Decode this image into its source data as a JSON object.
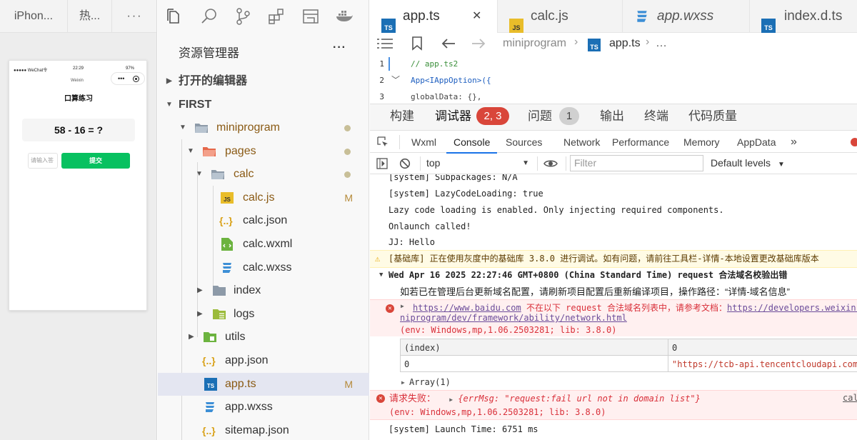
{
  "simulator": {
    "tabs": [
      "iPhon...",
      "热...",
      "···"
    ],
    "status_left": "●●●●● WeChat令",
    "status_time": "22:29",
    "status_battery": "97%",
    "nav_title": "Weixin",
    "page_title": "口算练习",
    "question": "58 - 16 = ?",
    "input_placeholder": "请输入答",
    "submit_label": "提交"
  },
  "explorer": {
    "title": "资源管理器",
    "more": "···",
    "open_editors": "打开的编辑器",
    "root": "FIRST",
    "tree": [
      {
        "label": "miniprogram",
        "status": ""
      },
      {
        "label": "pages",
        "status": ""
      },
      {
        "label": "calc",
        "status": ""
      },
      {
        "label": "calc.js",
        "status": "M"
      },
      {
        "label": "calc.json",
        "status": ""
      },
      {
        "label": "calc.wxml",
        "status": ""
      },
      {
        "label": "calc.wxss",
        "status": ""
      },
      {
        "label": "index",
        "status": ""
      },
      {
        "label": "logs",
        "status": ""
      },
      {
        "label": "utils",
        "status": ""
      },
      {
        "label": "app.json",
        "status": ""
      },
      {
        "label": "app.ts",
        "status": "M"
      },
      {
        "label": "app.wxss",
        "status": ""
      },
      {
        "label": "sitemap.json",
        "status": ""
      }
    ]
  },
  "editor": {
    "tabs": [
      {
        "label": "app.ts",
        "badge": "TS"
      },
      {
        "label": "calc.js",
        "badge": "JS"
      },
      {
        "label": "app.wxss",
        "badge": "CSS"
      },
      {
        "label": "index.d.ts",
        "badge": "TS"
      }
    ],
    "close_glyph": "✕",
    "breadcrumb": {
      "folder": "miniprogram",
      "file": "app.ts",
      "rest": "…"
    },
    "code": [
      {
        "num": "1",
        "text": "// app.ts2"
      },
      {
        "num": "2",
        "text": "App<IAppOption>({"
      },
      {
        "num": "3",
        "text": "  globalData: {},"
      }
    ]
  },
  "debug": {
    "tabs": [
      "构建",
      "调试器",
      "问题",
      "输出",
      "终端",
      "代码质量"
    ],
    "debugger_badge": "2, 3",
    "problems_badge": "1",
    "devtools_tabs": [
      "Wxml",
      "Console",
      "Sources",
      "Network",
      "Performance",
      "Memory",
      "AppData"
    ],
    "more_tabs": "»",
    "context": "top",
    "filter_placeholder": "Filter",
    "levels": "Default levels",
    "console": {
      "l1": "[system] Subpackages: N/A",
      "l2": "[system] LazyCodeLoading: true",
      "l3": "Lazy code loading is enabled. Only injecting required components.",
      "l4": "Onlaunch called!",
      "l5": "JJ:  Hello",
      "warn": "[基础库] 正在使用灰度中的基础库 3.8.0 进行调试。如有问题，请前往工具栏-详情-本地设置更改基础库版本",
      "group_header": "Wed Apr 16 2025 22:27:46 GMT+0800 (China Standard Time) request 合法域名校验出错",
      "group_info": "如若已在管理后台更新域名配置，请刷新项目配置后重新编译项目，操作路径：“详情-域名信息”",
      "err1_link": "https://www.baidu.com",
      "err1_text": " 不在以下 request 合法域名列表中，请参考文档：",
      "err1_doc": "https://developers.weixin.qq.com/miniprogram/dev/framework/ability/network.html",
      "err1_doc_cont": "niprogram/dev/framework/ability/network.html",
      "err1_env": "(env: Windows,mp,1.06.2503281; lib: 3.8.0)",
      "table_h1": "(index)",
      "table_h2": "0",
      "table_r1": "0",
      "table_r2": "\"https://tcb-api.tencentcloudapi.com\"",
      "array": "Array(1)",
      "err2_label": "请求失败：",
      "err2_obj": "{errMsg: \"request:fail url not in domain list\"}",
      "err2_src": "cal",
      "err2_env": "(env: Windows,mp,1.06.2503281; lib: 3.8.0)",
      "launch": "[system] Launch Time: 6751 ms"
    }
  }
}
